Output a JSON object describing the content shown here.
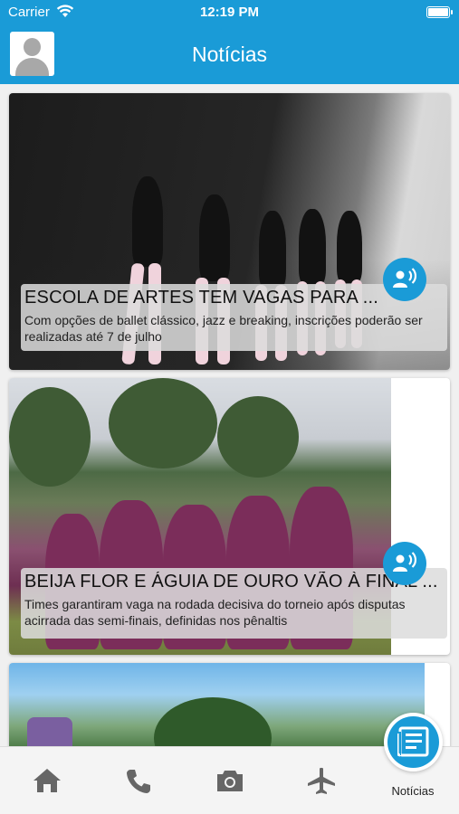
{
  "status_bar": {
    "carrier": "Carrier",
    "time": "12:19 PM"
  },
  "header": {
    "title": "Notícias"
  },
  "articles": [
    {
      "title": "ESCOLA DE ARTES TEM VAGAS PARA ...",
      "summary": "Com opções de ballet clássico, jazz e breaking, inscrições poderão ser realizadas até 7 de julho",
      "audio_icon": "speaker-voice-icon"
    },
    {
      "title": "BEIJA FLOR E ÁGUIA DE OURO VÃO À FINAL ...",
      "summary": "Times garantiram vaga na rodada decisiva do torneio após disputas acirrada das semi-finais, definidas nos pênaltis",
      "audio_icon": "speaker-voice-icon"
    }
  ],
  "tabbar": {
    "items": [
      {
        "icon": "home-icon"
      },
      {
        "icon": "phone-icon"
      },
      {
        "icon": "camera-icon"
      },
      {
        "icon": "airplane-icon"
      },
      {
        "icon": "news-icon",
        "label": "Notícias",
        "active": true
      }
    ]
  },
  "colors": {
    "accent": "#1a9bd7"
  }
}
